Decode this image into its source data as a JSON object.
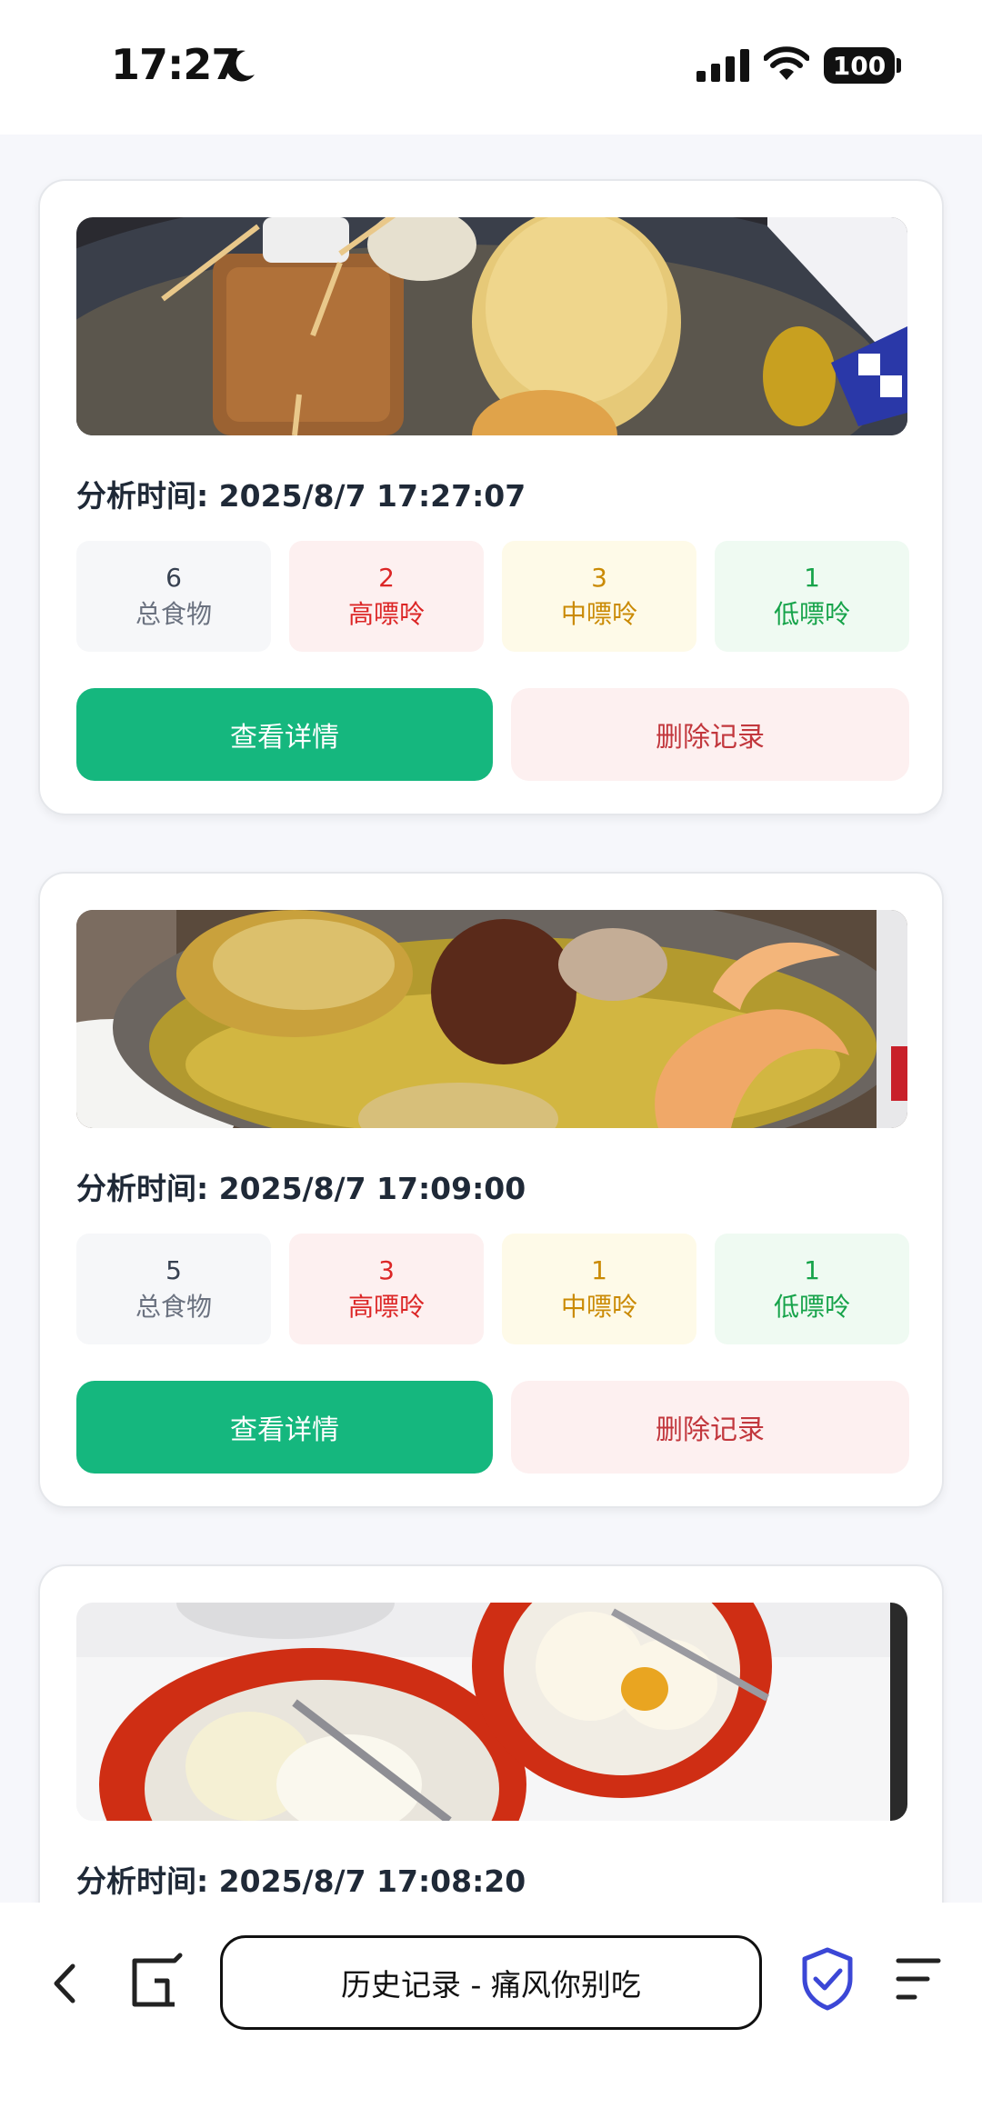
{
  "status_bar": {
    "time": "17:27",
    "battery": "100"
  },
  "records": [
    {
      "analysis_time": "分析时间: 2025/8/7 17:27:07",
      "stats": [
        {
          "value": "6",
          "label": "总食物"
        },
        {
          "value": "2",
          "label": "高嘌呤"
        },
        {
          "value": "3",
          "label": "中嘌呤"
        },
        {
          "value": "1",
          "label": "低嘌呤"
        }
      ],
      "view_label": "查看详情",
      "delete_label": "删除记录"
    },
    {
      "analysis_time": "分析时间: 2025/8/7 17:09:00",
      "stats": [
        {
          "value": "5",
          "label": "总食物"
        },
        {
          "value": "3",
          "label": "高嘌呤"
        },
        {
          "value": "1",
          "label": "中嘌呤"
        },
        {
          "value": "1",
          "label": "低嘌呤"
        }
      ],
      "view_label": "查看详情",
      "delete_label": "删除记录"
    },
    {
      "analysis_time": "分析时间: 2025/8/7 17:08:20"
    }
  ],
  "browser": {
    "address_text": "历史记录 - 痛风你别吃",
    "icons": [
      "back-icon",
      "tabs-icon",
      "shield-check-icon",
      "menu-icon"
    ]
  },
  "colors": {
    "primary": "#15b77e",
    "high": "#dc2626",
    "medium": "#ca8a04",
    "low": "#16a34a",
    "delete": "#c2373d"
  }
}
